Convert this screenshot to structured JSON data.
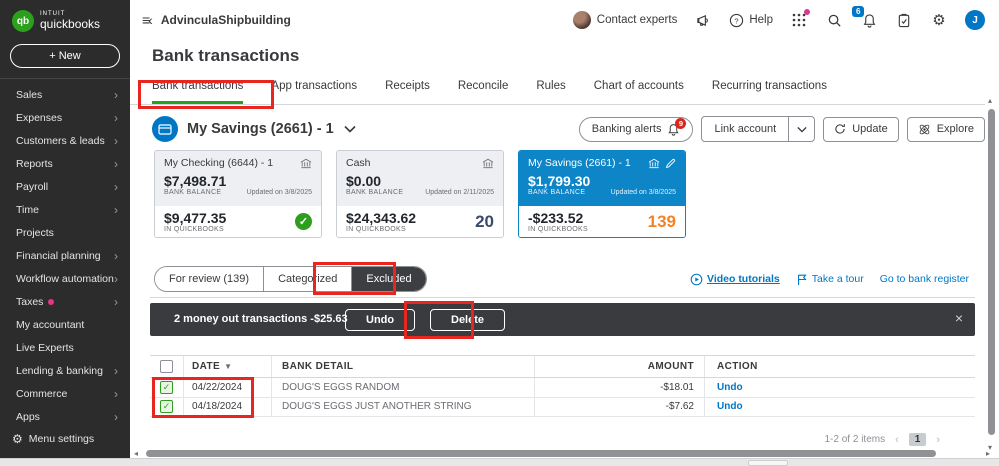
{
  "colors": {
    "brand_green": "#2ca01c",
    "accent_blue": "#0077c5",
    "count_orange": "#f6821f",
    "annotation_red": "#e8251f",
    "dark_bar": "#393b3e"
  },
  "sidebar": {
    "brand_top": "INTUIT",
    "brand_bottom": "quickbooks",
    "new_button": "+ New",
    "items": [
      {
        "label": "Sales"
      },
      {
        "label": "Expenses"
      },
      {
        "label": "Customers & leads"
      },
      {
        "label": "Reports"
      },
      {
        "label": "Payroll"
      },
      {
        "label": "Time"
      },
      {
        "label": "Projects"
      },
      {
        "label": "Financial planning"
      },
      {
        "label": "Workflow automation"
      },
      {
        "label": "Taxes"
      },
      {
        "label": "My accountant"
      },
      {
        "label": "Live Experts"
      },
      {
        "label": "Lending & banking"
      },
      {
        "label": "Commerce"
      },
      {
        "label": "Apps"
      }
    ],
    "menu_settings": "Menu settings"
  },
  "header": {
    "company": "AdvinculaShipbuilding",
    "contact_experts": "Contact experts",
    "help": "Help",
    "notification_count": "6",
    "avatar_initial": "J"
  },
  "page": {
    "title": "Bank transactions"
  },
  "tabs": [
    "Bank transactions",
    "App transactions",
    "Receipts",
    "Reconcile",
    "Rules",
    "Chart of accounts",
    "Recurring transactions"
  ],
  "account_bar": {
    "selected_account": "My Savings (2661) - 1",
    "banking_alerts": "Banking alerts",
    "alerts_count": "9",
    "link_account": "Link account",
    "update": "Update",
    "explore": "Explore"
  },
  "cards_labels": {
    "bank_balance": "BANK BALANCE",
    "in_quickbooks": "IN QUICKBOOKS"
  },
  "cards": [
    {
      "title": "My Checking (6644) - 1",
      "bank_balance": "$7,498.71",
      "updated": "Updated on 3/8/2025",
      "qb_balance": "$9,477.35",
      "count": ""
    },
    {
      "title": "Cash",
      "bank_balance": "$0.00",
      "updated": "Updated on 2/11/2025",
      "qb_balance": "$24,343.62",
      "count": "20"
    },
    {
      "title": "My Savings (2661) - 1",
      "bank_balance": "$1,799.30",
      "updated": "Updated on 3/8/2025",
      "qb_balance": "-$233.52",
      "count": "139"
    }
  ],
  "subtabs": [
    "For review (139)",
    "Categorized",
    "Excluded"
  ],
  "links": {
    "video_tutorials": "Video tutorials",
    "take_a_tour": "Take a tour",
    "go_to_register": "Go to bank register"
  },
  "action_bar": {
    "message": "2 money out transactions -$25.63",
    "undo": "Undo",
    "delete": "Delete",
    "close": "×"
  },
  "table": {
    "headers": {
      "date": "DATE",
      "detail": "BANK DETAIL",
      "amount": "AMOUNT",
      "action": "ACTION"
    },
    "rows": [
      {
        "date": "04/22/2024",
        "detail": "DOUG'S EGGS RANDOM",
        "amount": "-$18.01",
        "action": "Undo"
      },
      {
        "date": "04/18/2024",
        "detail": "DOUG'S EGGS JUST ANOTHER STRING",
        "amount": "-$7.62",
        "action": "Undo"
      }
    ]
  },
  "pagination": {
    "summary": "1-2 of 2 items",
    "page": "1"
  }
}
